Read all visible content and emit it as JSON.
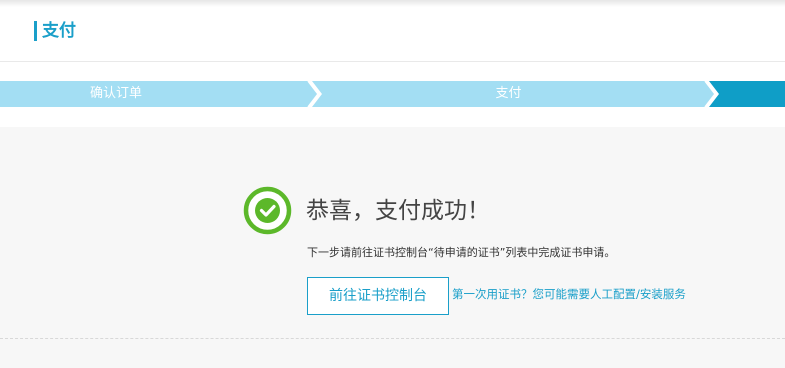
{
  "header": {
    "title": "支付"
  },
  "steps": [
    {
      "label": "确认订单",
      "state": "done"
    },
    {
      "label": "支付",
      "state": "done"
    },
    {
      "label": "",
      "state": "current"
    }
  ],
  "colors": {
    "accent": "#1a9fc9",
    "step_done": "#a3def3",
    "step_current": "#0f9ec7",
    "success_green": "#5cb82a",
    "panel_bg": "#f7f7f7"
  },
  "result": {
    "icon": "check-circle-icon",
    "title": "恭喜，支付成功！",
    "hint": "下一步请前往证书控制台“待申请的证书”列表中完成证书申请。",
    "button_label": "前往证书控制台",
    "help_link": "第一次用证书？您可能需要人工配置/安装服务"
  }
}
